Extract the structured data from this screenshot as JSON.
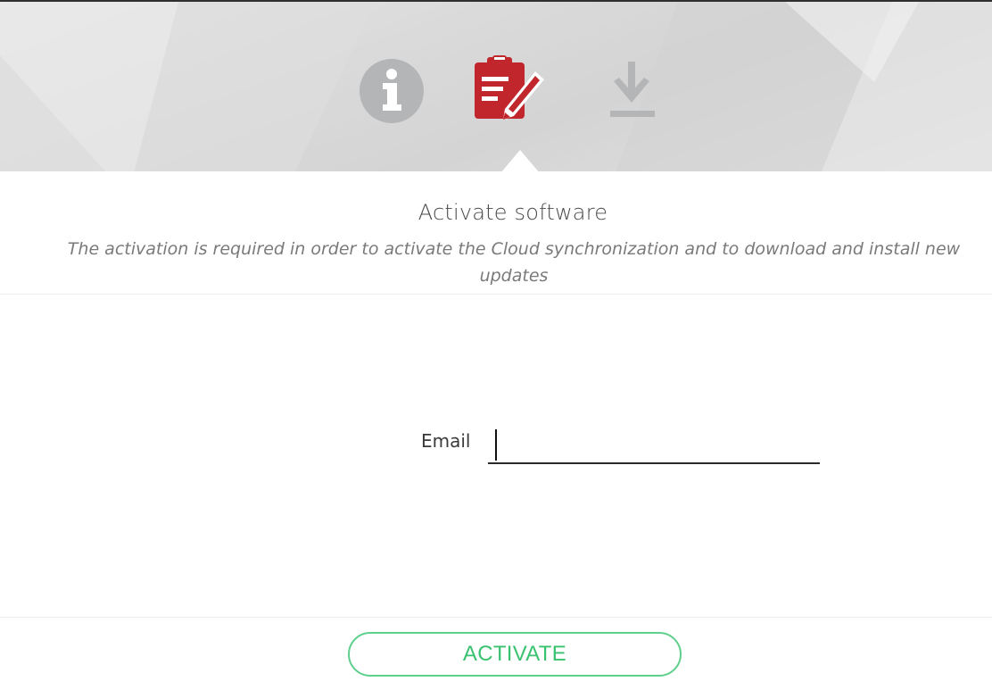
{
  "wizard": {
    "steps": [
      {
        "name": "info",
        "icon": "info-circle-icon",
        "state": "inactive"
      },
      {
        "name": "activate",
        "icon": "clipboard-edit-icon",
        "state": "active"
      },
      {
        "name": "download",
        "icon": "download-arrow-icon",
        "state": "inactive"
      }
    ]
  },
  "content": {
    "title": "Activate software",
    "subtitle": "The activation is required in order to activate the Cloud synchronization and to download and install new updates"
  },
  "form": {
    "email_label": "Email",
    "email_value": "",
    "email_placeholder": ""
  },
  "actions": {
    "activate_label": "ACTIVATE"
  },
  "colors": {
    "accent_active": "#c0262b",
    "inactive_icon": "#b3b5b7",
    "button_green": "#39c26f"
  }
}
